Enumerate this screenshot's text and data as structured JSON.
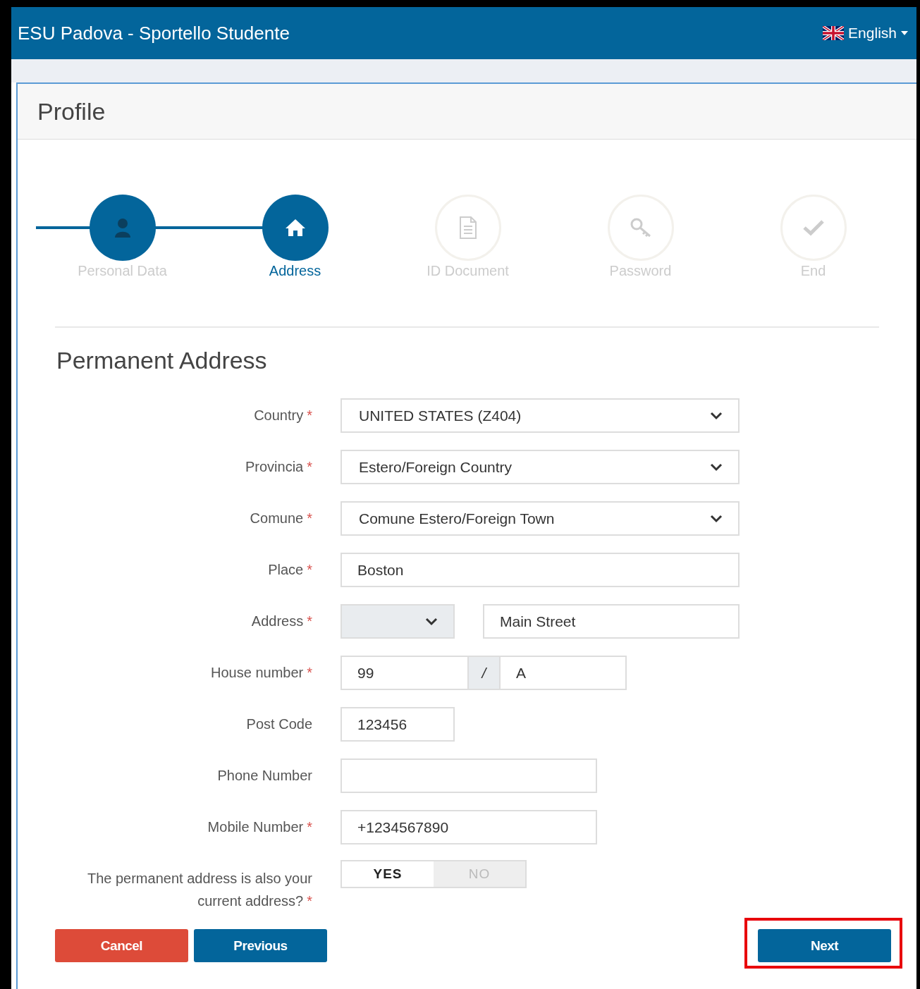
{
  "header": {
    "title": "ESU Padova - Sportello Studente",
    "language": "English"
  },
  "panel": {
    "title": "Profile"
  },
  "steps": [
    {
      "label": "Personal Data",
      "kind": "user",
      "completed": true,
      "selected": false
    },
    {
      "label": "Address",
      "kind": "home",
      "completed": false,
      "selected": true
    },
    {
      "label": "ID Document",
      "kind": "document",
      "completed": false,
      "selected": false
    },
    {
      "label": "Password",
      "kind": "key",
      "completed": false,
      "selected": false
    },
    {
      "label": "End",
      "kind": "check",
      "completed": false,
      "selected": false
    }
  ],
  "section_title": "Permanent Address",
  "rows": [
    {
      "label": "Country",
      "required_mark": "*",
      "kind": "select",
      "value": "UNITED STATES (Z404)"
    },
    {
      "label": "Provincia",
      "required_mark": "*",
      "kind": "select",
      "value": "Estero/Foreign Country"
    },
    {
      "label": "Comune",
      "required_mark": "*",
      "kind": "select",
      "value": "Comune Estero/Foreign Town"
    },
    {
      "label": "Place",
      "required_mark": "*",
      "kind": "text",
      "value": "Boston"
    },
    {
      "label": "Address",
      "required_mark": "*",
      "kind": "street",
      "value": "Main Street"
    },
    {
      "label": "House number",
      "required_mark": "*",
      "kind": "house",
      "value": "99",
      "separator": "/",
      "suffix": "A"
    },
    {
      "label": "Post Code",
      "kind": "short",
      "value": "123456"
    },
    {
      "label": "Phone Number",
      "kind": "medium"
    },
    {
      "label": "Mobile Number",
      "required_mark": "*",
      "kind": "medium",
      "value": "+1234567890"
    },
    {
      "label": "The permanent address is also your current address?",
      "required_mark": "*",
      "kind": "toggle",
      "options": [
        {
          "label": "YES",
          "selected": true
        },
        {
          "label": "NO",
          "selected": false
        }
      ]
    }
  ],
  "buttons": [
    {
      "label": "Cancel",
      "kind": "danger",
      "highlighted": false
    },
    {
      "label": "Previous",
      "kind": "primary",
      "highlighted": false
    },
    {
      "label": "Next",
      "kind": "primary",
      "highlighted": true
    }
  ]
}
